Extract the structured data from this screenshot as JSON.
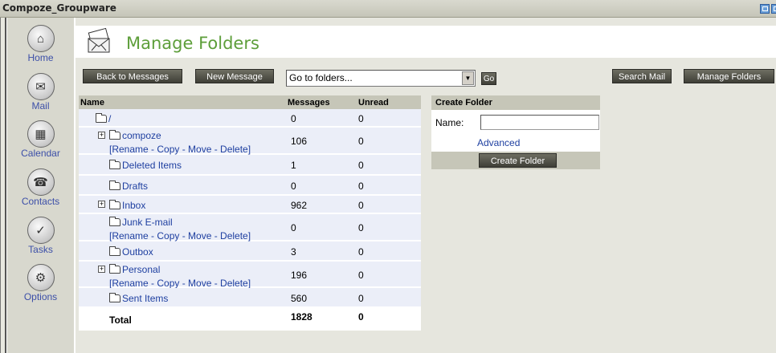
{
  "window": {
    "title": "Compoze_Groupware"
  },
  "sidebar": {
    "items": [
      {
        "label": "Home",
        "icon": "home-icon"
      },
      {
        "label": "Mail",
        "icon": "mail-icon"
      },
      {
        "label": "Calendar",
        "icon": "calendar-icon"
      },
      {
        "label": "Contacts",
        "icon": "contacts-icon"
      },
      {
        "label": "Tasks",
        "icon": "tasks-icon"
      },
      {
        "label": "Options",
        "icon": "options-icon"
      }
    ]
  },
  "page": {
    "title": "Manage Folders"
  },
  "toolbar": {
    "back_label": "Back to Messages",
    "new_label": "New Message",
    "goto_value": "Go to folders...",
    "go_label": "Go",
    "search_label": "Search Mail",
    "manage_label": "Manage Folders"
  },
  "table": {
    "headers": {
      "name": "Name",
      "messages": "Messages",
      "unread": "Unread"
    },
    "rows": [
      {
        "name": "/",
        "messages": "0",
        "unread": "0"
      },
      {
        "name": "compoze",
        "messages": "106",
        "unread": "0",
        "actions": "[Rename - Copy - Move - Delete]"
      },
      {
        "name": "Deleted Items",
        "messages": "1",
        "unread": "0"
      },
      {
        "name": "Drafts",
        "messages": "0",
        "unread": "0"
      },
      {
        "name": "Inbox",
        "messages": "962",
        "unread": "0"
      },
      {
        "name": "Junk E-mail",
        "messages": "0",
        "unread": "0",
        "actions": "[Rename - Copy - Move - Delete]"
      },
      {
        "name": "Outbox",
        "messages": "3",
        "unread": "0"
      },
      {
        "name": "Personal",
        "messages": "196",
        "unread": "0",
        "actions": "[Rename - Copy - Move - Delete]"
      },
      {
        "name": "Sent Items",
        "messages": "560",
        "unread": "0"
      }
    ],
    "total": {
      "label": "Total",
      "messages": "1828",
      "unread": "0"
    }
  },
  "create_folder": {
    "title": "Create Folder",
    "name_label": "Name:",
    "name_value": "",
    "advanced_label": "Advanced",
    "button_label": "Create Folder"
  }
}
